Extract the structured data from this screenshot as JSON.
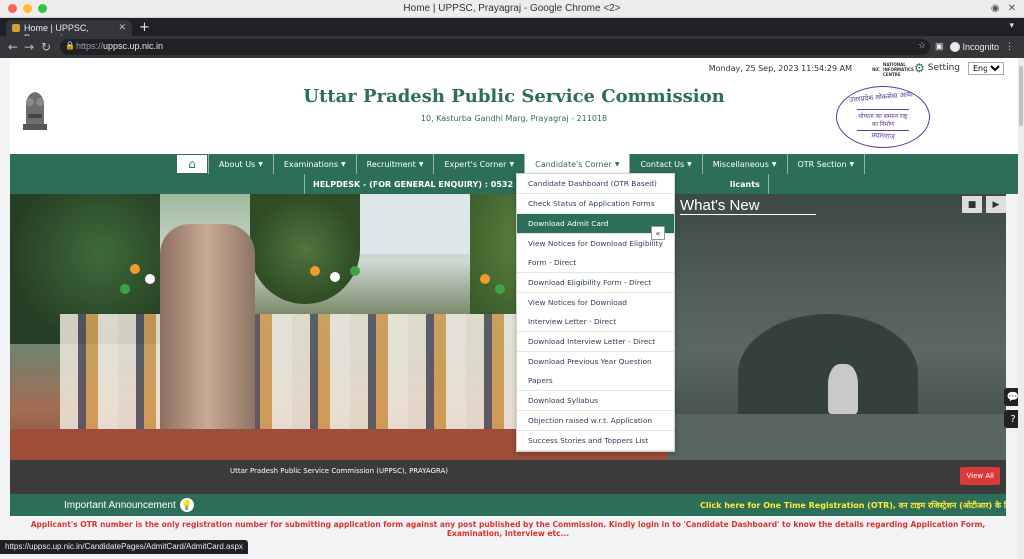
{
  "window": {
    "title": "Home | UPPSC, Prayagraj - Google Chrome <2>"
  },
  "tab": {
    "title": "Home | UPPSC, Prayagraj"
  },
  "address": {
    "scheme": "https://",
    "host": "uppsc.up.nic.in"
  },
  "browser": {
    "incognito_label": "Incognito"
  },
  "topbar": {
    "date": "Monday, 25 Sep, 2023 11:54:29 AM",
    "nic_logo": "NIC",
    "nic_sub": "NATIONAL INFORMATICS CENTRE",
    "setting_label": "Setting",
    "language": "English"
  },
  "header": {
    "title": "Uttar Pradesh Public Service Commission",
    "address": "10, Kasturba Gandhi Marg, Prayagraj - 211018",
    "seal_top": "उत्तरप्रदेश लोकसेवा आयोग",
    "seal_mid": "योग्यता का सम्मान राष्ट्र का निर्माण",
    "seal_bottom": "प्रयागराज"
  },
  "nav": {
    "items": [
      {
        "label": "About Us"
      },
      {
        "label": "Examinations"
      },
      {
        "label": "Recruitment"
      },
      {
        "label": "Expert's Corner"
      },
      {
        "label": "Candidate's Corner"
      },
      {
        "label": "Contact Us"
      },
      {
        "label": "Miscellaneous"
      },
      {
        "label": "OTR Section"
      }
    ],
    "helpdesk": "HELPDESK - (FOR GENERAL ENQUIRY) : 0532 - 2407547",
    "applicants": "licants"
  },
  "dropdown": {
    "items": [
      "Candidate Dashboard (OTR Based)",
      "Check Status of Application Forms",
      "Download Admit Card",
      "View Notices for Download Eligibility Form - Direct",
      "Download Eligibility Form - Direct",
      "View Notices for Download Interview Letter - Direct",
      "Download Interview Letter - Direct",
      "Download Previous Year Question Papers",
      "Download Syllabus",
      "Objection raised w.r.t. Application",
      "Success Stories and Toppers List"
    ],
    "active_index": 2
  },
  "slider": {
    "caption": "Uttar Pradesh Public Service Commission (UPPSC), PRAYAGRA)"
  },
  "whats_new": {
    "title": "What's New",
    "view_all": "View All"
  },
  "announcement": {
    "label": "Important Announcement",
    "ticker": "Click here for One Time Registration (OTR), वन टाइम रजिस्ट्रेशन (ओटीआर) के लिए यहां क्लिक"
  },
  "notice": "Applicant's OTR number is the only registration number for submitting application form against any post published by the Commission. Kindly login in to 'Candidate Dashboard' to know the details regarding Application Form, Examination, Interview etc...",
  "status_url": "https://uppsc.up.nic.in/CandidatePages/AdmitCard/AdmitCard.aspx",
  "colors": {
    "brand_green": "#2d6e59",
    "notice_red": "#e03030",
    "ticker_yellow": "#ffeb3b"
  }
}
